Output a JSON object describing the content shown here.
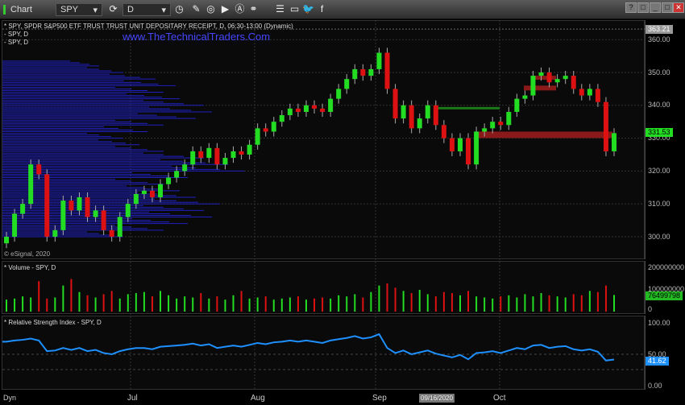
{
  "window": {
    "title": "Chart",
    "symbol": "SPY",
    "interval": "D",
    "buttons": [
      "?",
      "□",
      "_",
      "□",
      "✕"
    ]
  },
  "header": {
    "description": "* SPY, SPDR S&P500 ETF TRUST TRUST UNIT DEPOSITARY RECEIPT, D, 06:30-13:00 (Dynamic)",
    "sub1": "- SPY, D",
    "sub2": "- SPY, D",
    "watermark": "www.TheTechnicalTraders.Com",
    "copyright": "© eSignal, 2020"
  },
  "price_axis": {
    "ticks": [
      "360.00",
      "350.00",
      "340.00",
      "330.00",
      "320.00",
      "310.00",
      "300.00"
    ],
    "high_tag": "363.21",
    "last_tag": "331.53"
  },
  "volume": {
    "title": "* Volume - SPY, D",
    "ticks": [
      "200000000",
      "100000000",
      "0"
    ],
    "last_tag": "76499798"
  },
  "rsi": {
    "title": "* Relative Strength Index - SPY, D",
    "ticks": [
      "100.00",
      "50.00",
      "0.00"
    ],
    "last_tag": "41.62"
  },
  "x_axis": {
    "dyn": "Dyn",
    "months": [
      "Jul",
      "Aug",
      "Sep",
      "Oct"
    ],
    "cursor_date": "09/16/2020"
  },
  "colors": {
    "up": "#22dd22",
    "down": "#dd1111",
    "rsi": "#1e90ff",
    "profile": "#2020c0",
    "vol_tag": "#22bb22"
  },
  "chart_data": {
    "type": "candlestick",
    "closes": [
      300,
      307,
      310,
      322,
      319,
      300,
      302,
      311,
      308,
      312,
      306,
      308,
      302,
      300,
      306,
      310,
      313,
      314,
      312,
      316,
      318,
      320,
      322,
      326,
      324,
      327,
      322,
      324,
      326,
      325,
      328,
      333,
      332,
      335,
      337,
      339,
      338,
      340,
      339,
      338,
      342,
      345,
      348,
      351,
      349,
      351,
      356,
      345,
      336,
      340,
      333,
      336,
      340,
      334,
      330,
      326,
      330,
      322,
      332,
      333,
      335,
      334,
      338,
      342,
      343,
      349,
      350,
      347,
      348,
      349,
      345,
      343,
      345,
      341,
      326,
      331.53
    ],
    "volume_millions": [
      55,
      60,
      70,
      65,
      140,
      60,
      65,
      120,
      150,
      90,
      75,
      65,
      80,
      95,
      60,
      80,
      85,
      90,
      70,
      95,
      75,
      60,
      70,
      65,
      85,
      60,
      70,
      55,
      75,
      95,
      60,
      65,
      70,
      55,
      60,
      65,
      70,
      55,
      60,
      65,
      60,
      75,
      70,
      80,
      65,
      90,
      120,
      130,
      110,
      95,
      85,
      100,
      80,
      70,
      90,
      85,
      75,
      95,
      70,
      65,
      60,
      70,
      75,
      65,
      80,
      70,
      85,
      75,
      70,
      65,
      80,
      75,
      95,
      90,
      120,
      76.5
    ],
    "rsi": [
      70,
      72,
      73,
      75,
      72,
      55,
      56,
      60,
      57,
      60,
      55,
      57,
      52,
      50,
      55,
      58,
      60,
      60,
      58,
      62,
      63,
      64,
      65,
      67,
      64,
      66,
      60,
      62,
      64,
      62,
      65,
      68,
      66,
      69,
      70,
      72,
      70,
      72,
      70,
      68,
      72,
      74,
      76,
      79,
      75,
      77,
      82,
      60,
      52,
      56,
      50,
      53,
      56,
      51,
      48,
      45,
      49,
      42,
      52,
      53,
      55,
      52,
      56,
      60,
      58,
      64,
      65,
      60,
      62,
      63,
      58,
      56,
      58,
      54,
      40,
      41.62
    ],
    "profile": [
      [
        300,
        150
      ],
      [
        302,
        200
      ],
      [
        304,
        230
      ],
      [
        306,
        260
      ],
      [
        308,
        250
      ],
      [
        310,
        270
      ],
      [
        312,
        240
      ],
      [
        314,
        220
      ],
      [
        316,
        200
      ],
      [
        318,
        230
      ],
      [
        320,
        300
      ],
      [
        322,
        280
      ],
      [
        324,
        250
      ],
      [
        326,
        200
      ],
      [
        328,
        170
      ],
      [
        330,
        150
      ],
      [
        332,
        180
      ],
      [
        334,
        200
      ],
      [
        336,
        240
      ],
      [
        338,
        260
      ],
      [
        340,
        250
      ],
      [
        342,
        220
      ],
      [
        344,
        200
      ],
      [
        346,
        215
      ],
      [
        348,
        190
      ],
      [
        350,
        150
      ],
      [
        352,
        120
      ]
    ],
    "price_range": [
      297,
      364
    ],
    "volume_range": [
      0,
      240000000
    ],
    "rsi_range": [
      0,
      100
    ]
  }
}
